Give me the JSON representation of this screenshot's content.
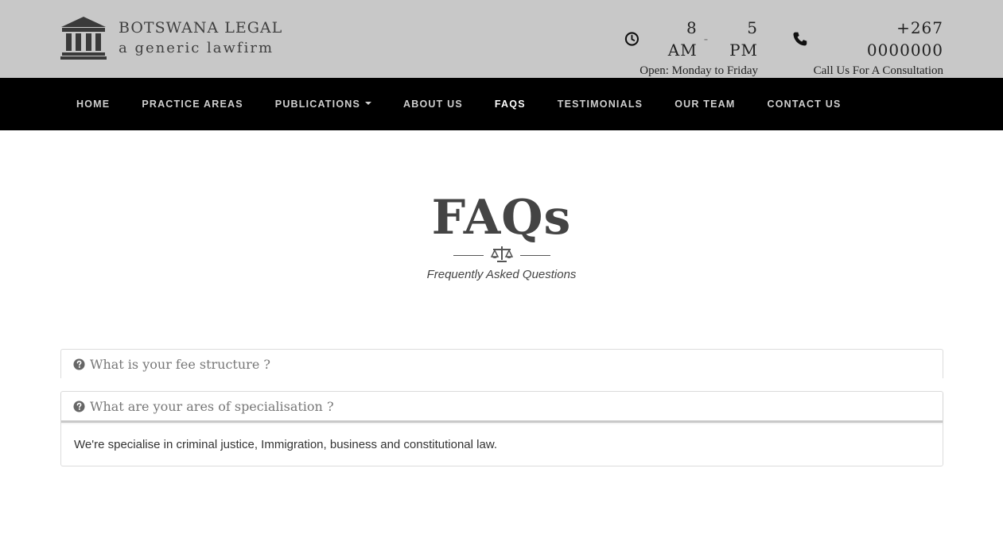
{
  "brand": {
    "name": "BOTSWANA LEGAL",
    "tagline": "a generic lawfirm",
    "logo_icon": "courthouse-icon"
  },
  "header": {
    "hours": {
      "icon": "clock-icon",
      "open": "8 AM",
      "separator": "-",
      "close": "5 PM",
      "days": "Open: Monday to Friday"
    },
    "phone": {
      "icon": "phone-icon",
      "number": "+267 0000000",
      "cta": "Call Us For A Consultation"
    }
  },
  "nav": {
    "items": [
      {
        "label": "HOME"
      },
      {
        "label": "PRACTICE AREAS"
      },
      {
        "label": "PUBLICATIONS"
      },
      {
        "label": "ABOUT US"
      },
      {
        "label": "FAQS"
      },
      {
        "label": "TESTIMONIALS"
      },
      {
        "label": "OUR TEAM"
      },
      {
        "label": "CONTACT US"
      }
    ],
    "active": "FAQS"
  },
  "hero": {
    "title": "FAQs",
    "divider_icon": "scales-icon",
    "subtitle": "Frequently Asked Questions"
  },
  "faqs": [
    {
      "question": "What is your fee structure ?",
      "expanded": false
    },
    {
      "question": "What are your ares of specialisation ?",
      "expanded": true,
      "answer": "We're specialise in criminal justice, Immigration, business and constitutional law."
    }
  ],
  "colors": {
    "topbar_bg": "#c8c8c8",
    "navbar_bg": "#000000",
    "nav_text": "#cfcfcf",
    "nav_active": "#ffffff",
    "title_text": "#444444"
  }
}
